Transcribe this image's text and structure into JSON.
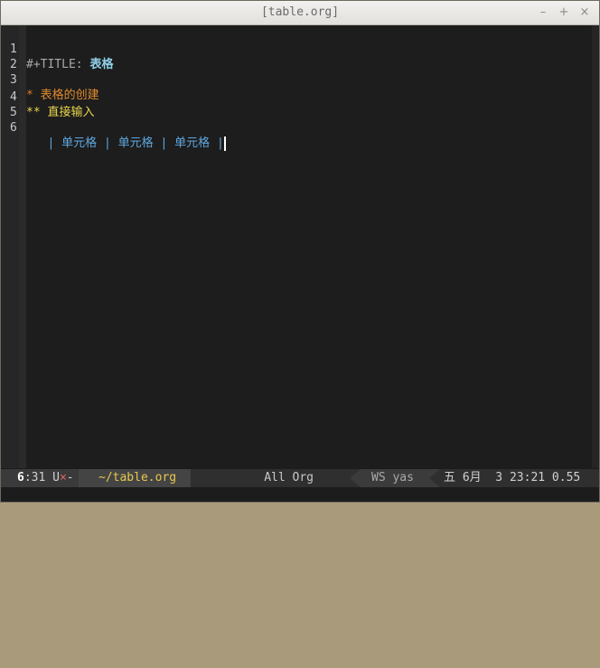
{
  "window": {
    "title": "[table.org]",
    "buttons": {
      "minimize": "–",
      "maximize": "+",
      "close": "×"
    }
  },
  "editor": {
    "lines": [
      {
        "num": "1",
        "keyword": "#+TITLE:",
        "value": "表格"
      },
      {
        "num": "2"
      },
      {
        "num": "3",
        "stars": "*",
        "text": "表格的创建"
      },
      {
        "num": "4",
        "stars": "**",
        "text": "直接输入"
      },
      {
        "num": "5"
      },
      {
        "num": "6",
        "cells": [
          "单元格",
          "单元格",
          "单元格"
        ],
        "pipe": "|"
      }
    ]
  },
  "modeline": {
    "line": "6",
    "col": ":31",
    "encoding": "U",
    "modified": "×",
    "dash": "-",
    "buffer": "~/table.org",
    "position": "All",
    "mode": "Org",
    "minor_modes": "WS yas",
    "time": "五 6月  3 23:21 0.55"
  },
  "colors": {
    "background": "#1d1d1d",
    "title_color": "#8fd1e8",
    "heading1": "#e08a2c",
    "heading2": "#e8d44a",
    "table": "#5fa8e0",
    "buffer_name": "#e8c84a"
  }
}
